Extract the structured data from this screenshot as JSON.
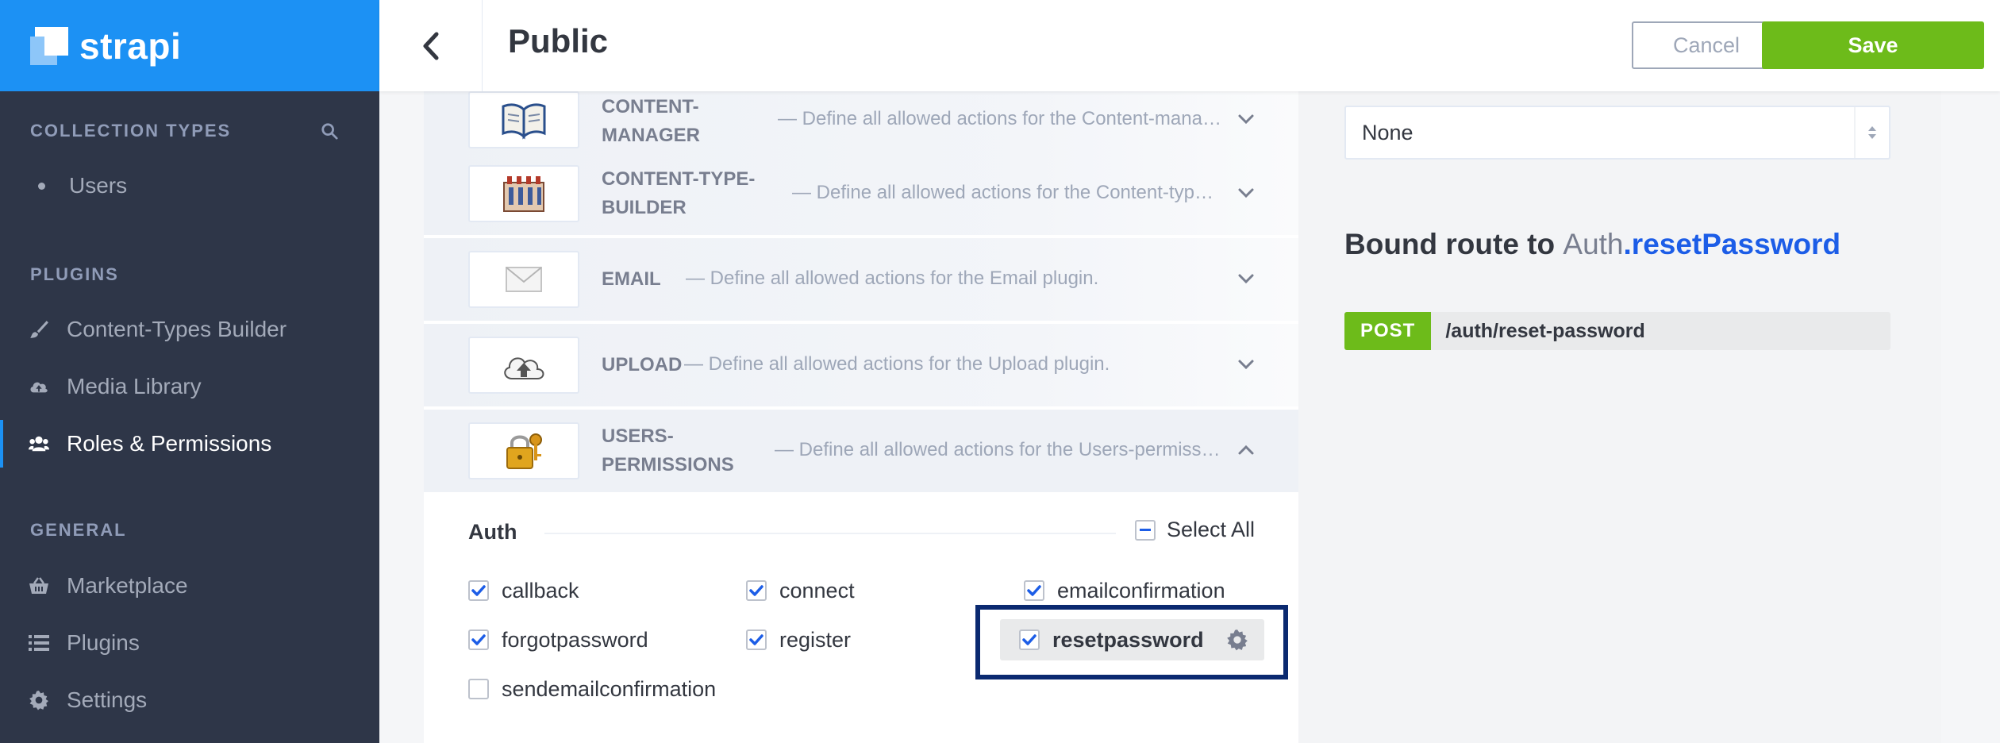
{
  "brand": {
    "name": "strapi",
    "color": "#1c91f4"
  },
  "sidebar": {
    "sections": [
      {
        "title": "COLLECTION TYPES",
        "items": [
          {
            "label": "Users",
            "icon": "bullet"
          }
        ]
      },
      {
        "title": "PLUGINS",
        "items": [
          {
            "label": "Content-Types Builder",
            "icon": "brush-icon"
          },
          {
            "label": "Media Library",
            "icon": "cloud-upload-icon"
          },
          {
            "label": "Roles & Permissions",
            "icon": "users-icon",
            "active": true
          }
        ]
      },
      {
        "title": "GENERAL",
        "items": [
          {
            "label": "Marketplace",
            "icon": "basket-icon"
          },
          {
            "label": "Plugins",
            "icon": "list-icon"
          },
          {
            "label": "Settings",
            "icon": "gear-icon"
          }
        ]
      }
    ]
  },
  "header": {
    "title": "Public",
    "cancel_label": "Cancel",
    "save_label": "Save"
  },
  "plugins": [
    {
      "name_line1": "CONTENT-",
      "name_line2": "MANAGER",
      "description": "— Define all allowed actions for the Content-manage…",
      "icon": "book-icon",
      "expanded": false
    },
    {
      "name_line1": "CONTENT-TYPE-",
      "name_line2": "BUILDER",
      "description": "— Define all allowed actions for the Content-type-…",
      "icon": "factory-icon",
      "expanded": false
    },
    {
      "name_line1": "EMAIL",
      "name_line2": "",
      "description": "— Define all allowed actions for the Email plugin.",
      "icon": "envelope-icon",
      "expanded": false
    },
    {
      "name_line1": "UPLOAD",
      "name_line2": "",
      "description": "— Define all allowed actions for the Upload plugin.",
      "icon": "cloud-upload-icon",
      "expanded": false
    },
    {
      "name_line1": "USERS-",
      "name_line2": "PERMISSIONS",
      "description": "— Define all allowed actions for the Users-permissio…",
      "icon": "padlock-icon",
      "expanded": true
    }
  ],
  "auth": {
    "title": "Auth",
    "select_all_label": "Select All",
    "permissions": [
      {
        "label": "callback",
        "checked": true
      },
      {
        "label": "connect",
        "checked": true
      },
      {
        "label": "emailconfirmation",
        "checked": true
      },
      {
        "label": "forgotpassword",
        "checked": true
      },
      {
        "label": "register",
        "checked": true
      },
      {
        "label": "resetpassword",
        "checked": true,
        "selected": true
      },
      {
        "label": "sendemailconfirmation",
        "checked": false
      }
    ]
  },
  "policy": {
    "selected": "None"
  },
  "bound_route": {
    "prefix": "Bound route to ",
    "controller": "Auth",
    "action": ".resetPassword",
    "method": "POST",
    "path": "/auth/reset-password"
  },
  "colors": {
    "accent": "#1c5de7",
    "save": "#6dbb1a",
    "sidebar": "#2e3648",
    "highlight": "#0a2970"
  }
}
